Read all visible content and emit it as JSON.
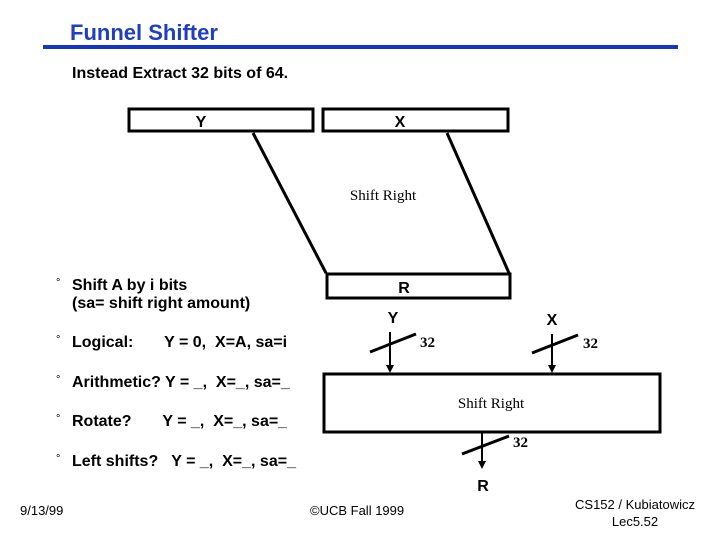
{
  "slide": {
    "title": "Funnel Shifter",
    "subtitle": "Instead Extract 32 bits of 64."
  },
  "diagram_top": {
    "input_left_label": "Y",
    "input_right_label": "X",
    "operation_label": "Shift Right",
    "output_label": "R"
  },
  "diagram_bottom": {
    "input_left_label": "Y",
    "input_right_label": "X",
    "input_left_width": "32",
    "input_right_width": "32",
    "operation_label": "Shift Right",
    "output_width": "32",
    "output_label": "R"
  },
  "bullets": [
    {
      "marker": "°",
      "text": "Shift A by i bits\n(sa= shift right amount)"
    },
    {
      "marker": "°",
      "text": "Logical:       Y = 0,  X=A, sa=i"
    },
    {
      "marker": "°",
      "text": "Arithmetic? Y = _,  X=_, sa=_"
    },
    {
      "marker": "°",
      "text": "Rotate?       Y = _,  X=_, sa=_"
    },
    {
      "marker": "°",
      "text": "Left shifts?   Y = _,  X=_, sa=_"
    }
  ],
  "footer": {
    "date": "9/13/99",
    "copyright": "©UCB Fall 1999",
    "course": "CS152 / Kubiatowicz",
    "lecture": "Lec5.52"
  },
  "colors": {
    "title": "#1f3ec4",
    "rule": "#1436c8"
  }
}
